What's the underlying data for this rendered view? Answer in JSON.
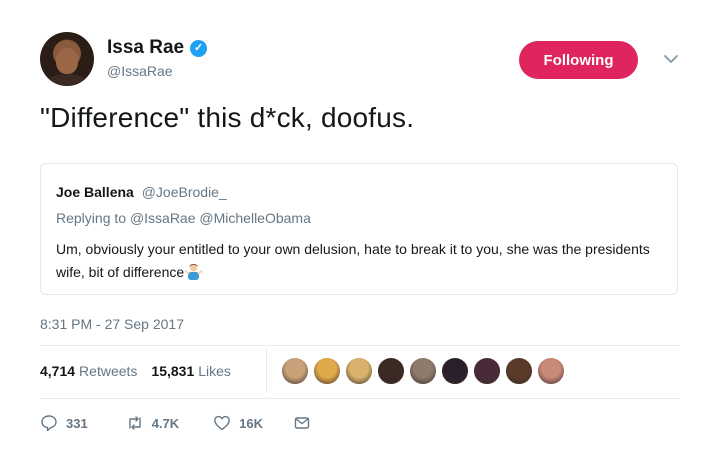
{
  "author": {
    "name": "Issa Rae",
    "handle": "@IssaRae",
    "verified_mark": "✓"
  },
  "follow_button": {
    "label": "Following"
  },
  "tweet": {
    "text": "\"Difference\" this d*ck, doofus."
  },
  "quoted": {
    "name": "Joe Ballena",
    "handle": "@JoeBrodie_",
    "replying_prefix": "Replying to",
    "replying_to": [
      "@IssaRae",
      "@MichelleObama"
    ],
    "body": "Um, obviously your entitled to your own delusion, hate to break it to you, she was the presidents wife, bit of difference"
  },
  "timestamp": "8:31 PM - 27 Sep 2017",
  "stats": {
    "retweets_count": "4,714",
    "retweets_label": "Retweets",
    "likes_count": "15,831",
    "likes_label": "Likes"
  },
  "likers": [
    "#c9a27a",
    "#e0a94a",
    "#d9b36b",
    "#3b2a23",
    "#8d7b6c",
    "#2a1e2b",
    "#4a2a3a",
    "#5b3a2a",
    "#c98a78"
  ],
  "actions": {
    "reply_count": "331",
    "retweet_count": "4.7K",
    "like_count": "16K"
  },
  "colors": {
    "follow_bg": "#e0245e",
    "verified": "#1da1f2",
    "muted": "#657786"
  },
  "icons": [
    "verified-badge-icon",
    "chevron-down-icon",
    "shrug-emoji-icon",
    "reply-icon",
    "retweet-icon",
    "like-icon",
    "direct-message-icon"
  ]
}
